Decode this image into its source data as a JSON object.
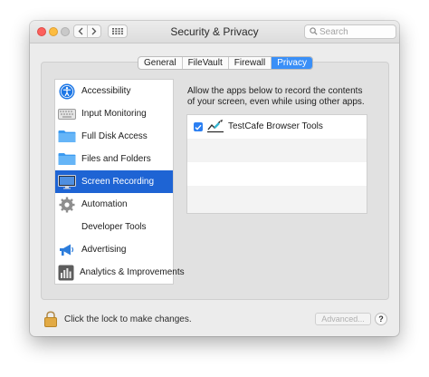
{
  "window": {
    "title": "Security & Privacy"
  },
  "toolbar": {
    "back_icon": "chevron-left-icon",
    "forward_icon": "chevron-right-icon",
    "grid_icon": "grid-icon"
  },
  "search": {
    "placeholder": "Search"
  },
  "tabs": [
    {
      "label": "General",
      "active": false
    },
    {
      "label": "FileVault",
      "active": false
    },
    {
      "label": "Firewall",
      "active": false
    },
    {
      "label": "Privacy",
      "active": true
    }
  ],
  "sidebar": {
    "items": [
      {
        "label": "Accessibility",
        "icon": "accessibility-icon",
        "selected": false
      },
      {
        "label": "Input Monitoring",
        "icon": "keyboard-icon",
        "selected": false
      },
      {
        "label": "Full Disk Access",
        "icon": "folder-icon",
        "selected": false
      },
      {
        "label": "Files and Folders",
        "icon": "folder-icon",
        "selected": false
      },
      {
        "label": "Screen Recording",
        "icon": "display-icon",
        "selected": true
      },
      {
        "label": "Automation",
        "icon": "gear-icon",
        "selected": false
      },
      {
        "label": "Developer Tools",
        "icon": "",
        "selected": false
      },
      {
        "label": "Advertising",
        "icon": "megaphone-icon",
        "selected": false
      },
      {
        "label": "Analytics & Improvements",
        "icon": "bar-chart-icon",
        "selected": false
      }
    ]
  },
  "detail": {
    "description": "Allow the apps below to record the contents of your screen, even while using other apps.",
    "apps": [
      {
        "name": "TestCafe Browser Tools",
        "checked": true,
        "icon": "testcafe-icon"
      }
    ]
  },
  "footer": {
    "lock_text": "Click the lock to make changes.",
    "advanced_label": "Advanced...",
    "help_label": "?"
  },
  "colors": {
    "accent": "#3a8ff7",
    "selection": "#1e64d4"
  }
}
